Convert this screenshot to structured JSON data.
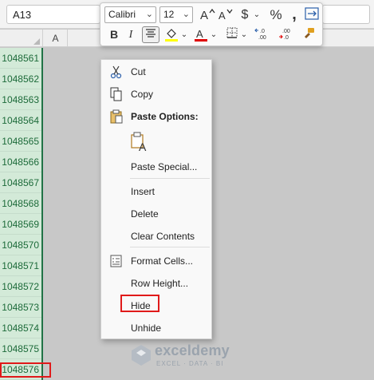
{
  "namebox": {
    "value": "A13"
  },
  "column_header": {
    "label": "A"
  },
  "row_headers": [
    "1048561",
    "1048562",
    "1048563",
    "1048564",
    "1048565",
    "1048566",
    "1048567",
    "1048568",
    "1048569",
    "1048570",
    "1048571",
    "1048572",
    "1048573",
    "1048574",
    "1048575",
    "1048576"
  ],
  "mini_toolbar": {
    "font": "Calibri",
    "size": "12",
    "grow_font": "A^",
    "shrink_font": "Aˇ",
    "currency": "$",
    "percent": "%",
    "comma": "❟",
    "bold": "B",
    "italic": "I",
    "font_color_letter": "A",
    "increase_decimal": "+.0 .00",
    "decrease_decimal": ".00 →.0",
    "fill_color": "#ffff00",
    "font_color": "#e00000"
  },
  "context_menu": {
    "cut": "Cut",
    "copy": "Copy",
    "paste_options": "Paste Options:",
    "paste_special": "Paste Special...",
    "insert": "Insert",
    "delete": "Delete",
    "clear_contents": "Clear Contents",
    "format_cells": "Format Cells...",
    "row_height": "Row Height...",
    "hide": "Hide",
    "unhide": "Unhide"
  },
  "watermark": {
    "name": "exceldemy",
    "tagline": "EXCEL · DATA · BI"
  },
  "colors": {
    "accent_green": "#217346",
    "row_header_bg": "#d3ead8",
    "highlight_red": "#e01a1a"
  }
}
